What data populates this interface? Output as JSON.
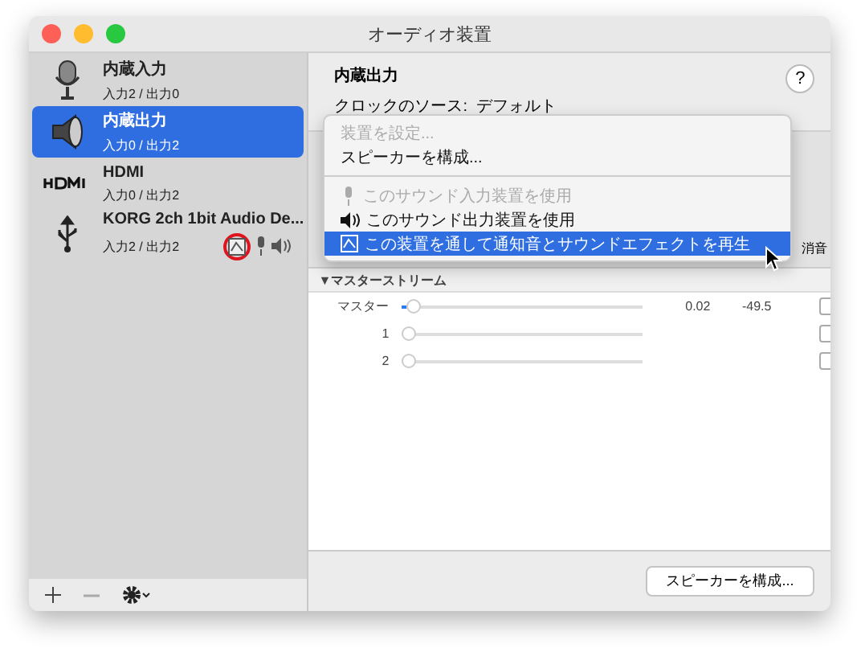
{
  "window": {
    "title": "オーディオ装置"
  },
  "devices": [
    {
      "kind": "microphone",
      "name": "内蔵入力",
      "channels": "入力2 / 出力0",
      "selected": false
    },
    {
      "kind": "speaker",
      "name": "内蔵出力",
      "channels": "入力0 / 出力2",
      "selected": true
    },
    {
      "kind": "hdmi",
      "name": "HDMI",
      "channels": "入力0 / 出力2",
      "selected": false
    },
    {
      "kind": "usb",
      "name": "KORG 2ch 1bit Audio De...",
      "channels": "入力2 / 出力2",
      "selected": false,
      "default_system": true,
      "default_input": true,
      "default_output": true,
      "circled": true
    }
  ],
  "detail": {
    "title": "内蔵出力",
    "clock_source": "クロックのソース:  デフォルト",
    "mute_label": "消音",
    "help_label": "?"
  },
  "stream": {
    "title": "▼マスターストリーム",
    "rows": [
      {
        "label": "マスター",
        "level": 0.02,
        "value": "0.02",
        "db": "-49.5",
        "checked": false
      },
      {
        "label": "1",
        "level": 0,
        "checked": false
      },
      {
        "label": "2",
        "level": 0,
        "checked": false
      }
    ]
  },
  "context_menu": {
    "items": [
      {
        "kind": "text",
        "label": "装置を設定...",
        "disabled": true,
        "selected": false
      },
      {
        "kind": "text",
        "label": "スピーカーを構成...",
        "disabled": false,
        "selected": false
      },
      {
        "kind": "separator"
      },
      {
        "kind": "input",
        "label": "このサウンド入力装置を使用",
        "disabled": true,
        "selected": false
      },
      {
        "kind": "output",
        "label": "このサウンド出力装置を使用",
        "disabled": false,
        "selected": false
      },
      {
        "kind": "system",
        "label": "この装置を通して通知音とサウンドエフェクトを再生",
        "disabled": false,
        "selected": true
      }
    ]
  },
  "footer_button": "スピーカーを構成..."
}
